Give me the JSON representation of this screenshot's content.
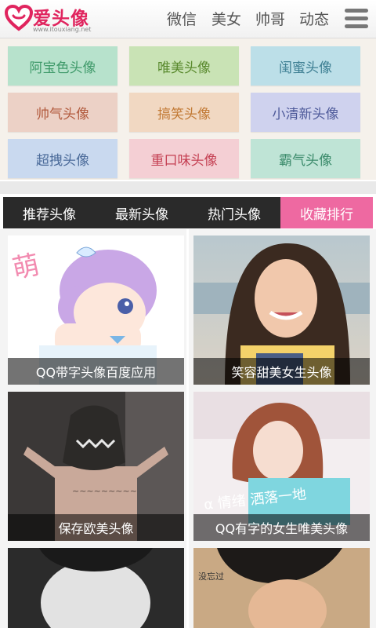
{
  "header": {
    "logo_text": "爱头像",
    "logo_url": "www.itouxiang.net",
    "nav": [
      "微信",
      "美女",
      "帅哥",
      "动态"
    ]
  },
  "categories": [
    {
      "label": "阿宝色头像",
      "bg": "#b7e2cc",
      "color": "#3f9a6a"
    },
    {
      "label": "唯美头像",
      "bg": "#c9e3b5",
      "color": "#5a8a2e"
    },
    {
      "label": "闺蜜头像",
      "bg": "#bcdfe8",
      "color": "#3e7f93"
    },
    {
      "label": "帅气头像",
      "bg": "#ecd1c6",
      "color": "#b25a3d"
    },
    {
      "label": "搞笑头像",
      "bg": "#f1d8c2",
      "color": "#c27a35"
    },
    {
      "label": "小清新头像",
      "bg": "#cfd2ee",
      "color": "#4e5a9a"
    },
    {
      "label": "超拽头像",
      "bg": "#c9d9ef",
      "color": "#4a6a99"
    },
    {
      "label": "重口味头像",
      "bg": "#f4cfd4",
      "color": "#c43f52"
    },
    {
      "label": "霸气头像",
      "bg": "#bfe4d6",
      "color": "#3a8a6a"
    }
  ],
  "tabs": [
    {
      "label": "推荐头像",
      "active": false
    },
    {
      "label": "最新头像",
      "active": false
    },
    {
      "label": "热门头像",
      "active": false
    },
    {
      "label": "收藏排行",
      "active": true
    }
  ],
  "thumbnails": [
    {
      "caption": "QQ带字头像百度应用"
    },
    {
      "caption": "笑容甜美女生头像"
    },
    {
      "caption": "保存欧美头像"
    },
    {
      "caption": "QQ有字的女生唯美头像"
    },
    {
      "caption": ""
    },
    {
      "caption": ""
    }
  ],
  "colors": {
    "accent": "#ee69a1",
    "logo": "#e0245e",
    "tabbar": "#2a2a2a"
  }
}
